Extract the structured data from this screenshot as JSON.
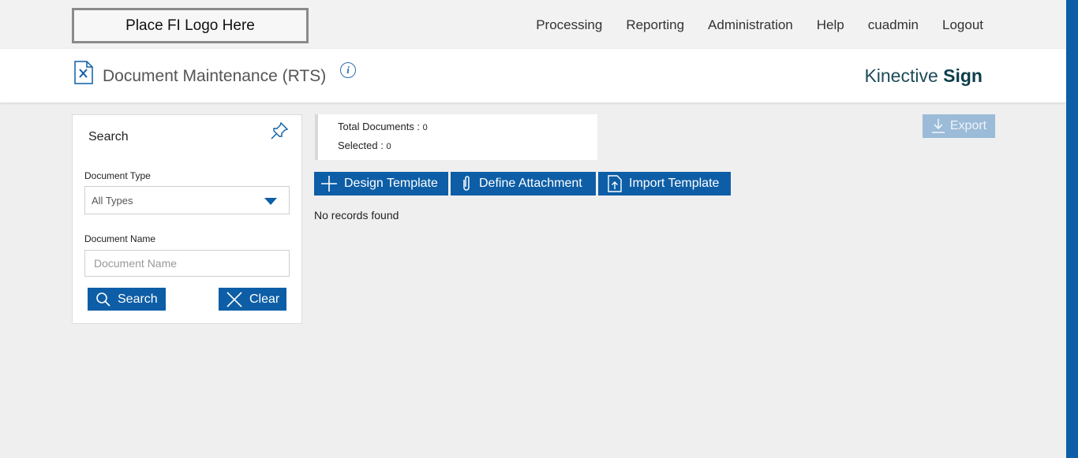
{
  "header": {
    "logo_text": "Place FI Logo Here",
    "nav": [
      "Processing",
      "Reporting",
      "Administration",
      "Help",
      "cuadmin",
      "Logout"
    ]
  },
  "title_bar": {
    "page_title": "Document Maintenance (RTS)",
    "info_icon_glyph": "i",
    "brand_light": "Kinective",
    "brand_bold": "Sign"
  },
  "search_panel": {
    "title": "Search",
    "document_type_label": "Document Type",
    "document_type_value": "All Types",
    "document_name_label": "Document Name",
    "document_name_placeholder": "Document Name",
    "search_button": "Search",
    "clear_button": "Clear"
  },
  "summary": {
    "total_label": "Total Documents : ",
    "total_value": "0",
    "selected_label": "Selected : ",
    "selected_value": "0"
  },
  "toolbar": {
    "export_label": "Export",
    "design_template": "Design Template",
    "define_attachment": "Define Attachment",
    "import_template": "Import Template"
  },
  "results": {
    "empty_message": "No records found"
  },
  "colors": {
    "primary": "#0d5ea6",
    "export_disabled": "#9bbbd8",
    "brand_text": "#0d3e4a"
  }
}
